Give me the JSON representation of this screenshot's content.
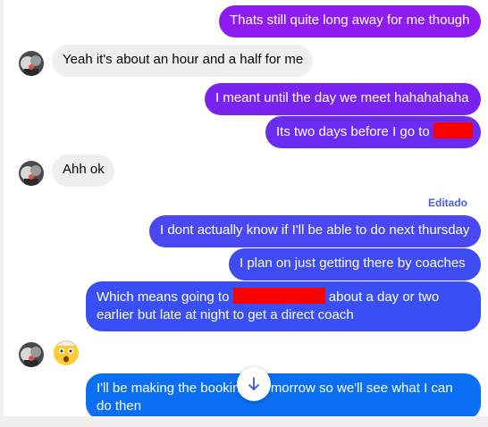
{
  "messages": [
    {
      "text": "Thats still quite long away for me though"
    },
    {
      "text": "Yeah it's about an hour and a half for me"
    },
    {
      "text": "I meant until the day we meet hahahahaha"
    },
    {
      "text": "Its two days before I go to"
    },
    {
      "text": "Ahh ok"
    },
    {
      "text": "I dont actually know if I'll be able to do next thursday"
    },
    {
      "text": "I plan on just getting there by coaches"
    },
    {
      "text_before": "Which means going to",
      "text_after": "about a day or two earlier but late at night to get a direct coach"
    },
    {
      "text_before": "I'll be making the bookin",
      "text_after": "morrow so we'll see what I can do then"
    }
  ],
  "edited_label": "Editado",
  "reaction_emoji": "astonished-face-emoji",
  "icons": {
    "scroll_down": "arrow-down-icon",
    "avatar": "contact-avatar"
  },
  "colors": {
    "sent_purple": "#8e1cf0",
    "sent_mid": "#6a2cf0",
    "sent_blue": "#3a4ef5",
    "sent_bottom": "#0a6ff2",
    "received": "#efefef",
    "redaction": "#ff0000",
    "edited": "#4a5cf0"
  }
}
